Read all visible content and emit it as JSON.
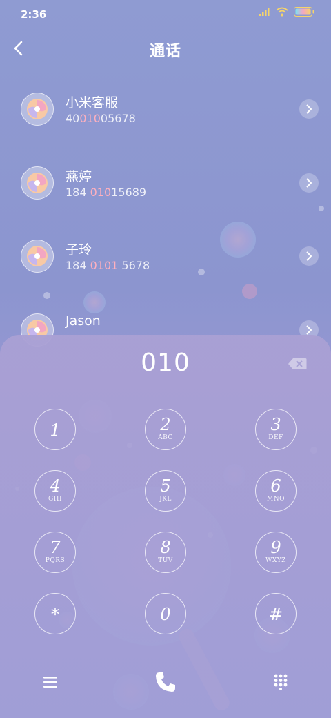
{
  "status": {
    "time": "2:36",
    "icons": [
      "signal-icon",
      "wifi-icon",
      "battery-icon"
    ]
  },
  "header": {
    "title": "通话",
    "back_icon": "back-arrow-icon"
  },
  "contacts": [
    {
      "name": "小米客服",
      "number_pre": "40",
      "number_hl": "010",
      "number_post": "05678"
    },
    {
      "name": "燕婷",
      "number_pre": "184 ",
      "number_hl": "010",
      "number_post": "15689"
    },
    {
      "name": "子玲",
      "number_pre": "184 ",
      "number_hl": "0101",
      "number_post": " 5678"
    },
    {
      "name": "Jason",
      "number_pre": "",
      "number_hl": "",
      "number_post": ""
    }
  ],
  "dialer": {
    "display": "010",
    "keys": [
      {
        "digit": "1",
        "letters": ""
      },
      {
        "digit": "2",
        "letters": "ABC"
      },
      {
        "digit": "3",
        "letters": "DEF"
      },
      {
        "digit": "4",
        "letters": "GHI"
      },
      {
        "digit": "5",
        "letters": "JKL"
      },
      {
        "digit": "6",
        "letters": "MNO"
      },
      {
        "digit": "7",
        "letters": "PQRS"
      },
      {
        "digit": "8",
        "letters": "TUV"
      },
      {
        "digit": "9",
        "letters": "WXYZ"
      },
      {
        "digit": "*",
        "letters": ""
      },
      {
        "digit": "0",
        "letters": ""
      },
      {
        "digit": "#",
        "letters": ""
      }
    ]
  },
  "bottombar": {
    "icons": [
      "menu-icon",
      "call-icon",
      "keypad-icon"
    ]
  },
  "colors": {
    "highlight": "#ffb0be",
    "accent_pink": "#f3a6c2"
  }
}
